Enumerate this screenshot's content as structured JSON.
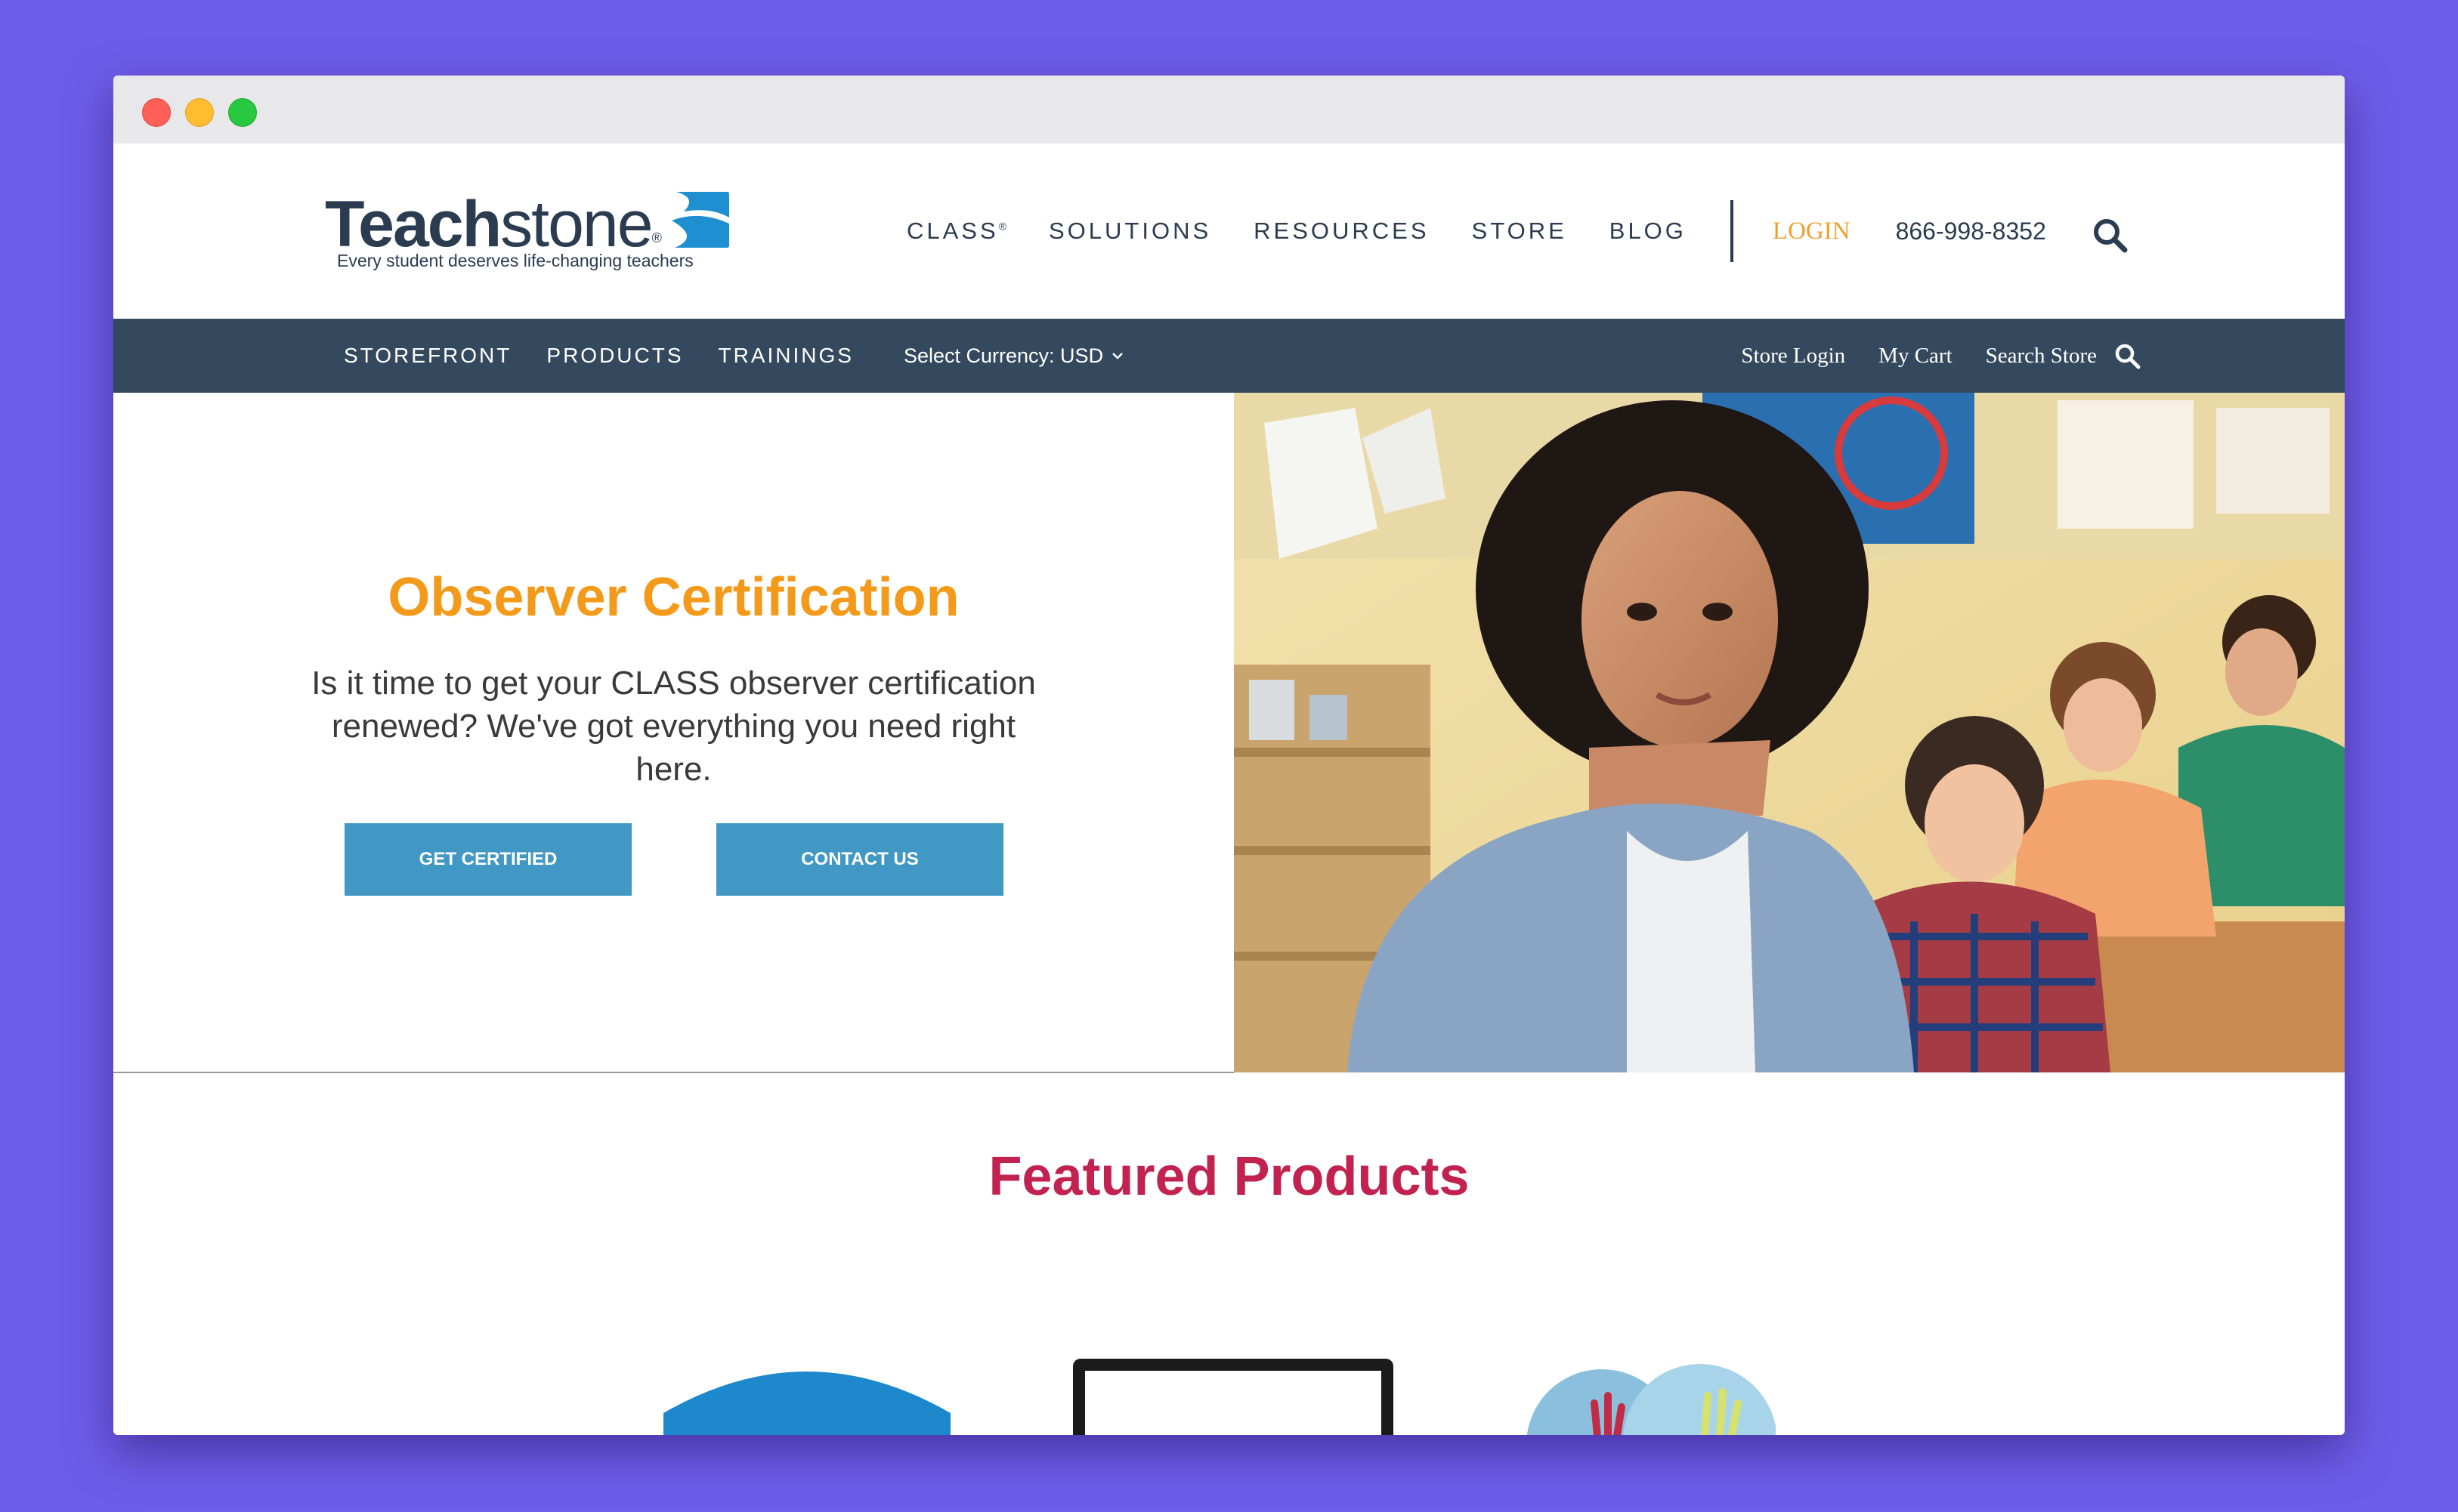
{
  "logo": {
    "word_bold": "Teach",
    "word_light": "stone",
    "registered": "®",
    "tagline": "Every student deserves life-changing teachers"
  },
  "main_nav": {
    "items": [
      {
        "label": "CLASS",
        "sup": "®"
      },
      {
        "label": "SOLUTIONS"
      },
      {
        "label": "RESOURCES"
      },
      {
        "label": "STORE"
      },
      {
        "label": "BLOG"
      }
    ],
    "login": "LOGIN",
    "phone": "866-998-8352"
  },
  "store_bar": {
    "left_links": [
      "STOREFRONT",
      "PRODUCTS",
      "TRAININGS"
    ],
    "currency_label": "Select Currency: USD",
    "right_links": [
      "Store Login",
      "My Cart",
      "Search Store"
    ]
  },
  "hero": {
    "title": "Observer Certification",
    "text": "Is it time to get your CLASS observer certification renewed? We've got everything you need right here.",
    "buttons": {
      "certify": "GET CERTIFIED",
      "contact": "CONTACT US"
    }
  },
  "featured": {
    "title": "Featured Products"
  },
  "icons": {
    "search": "search-icon",
    "chevron": "chevron-down-icon"
  },
  "colors": {
    "background": "#6e5de8",
    "navy": "#2b3c50",
    "store_bar": "#34495e",
    "accent_orange": "#f39a1a",
    "login_orange": "#f0a030",
    "button_blue": "#4298c5",
    "featured_red": "#c2224f"
  }
}
